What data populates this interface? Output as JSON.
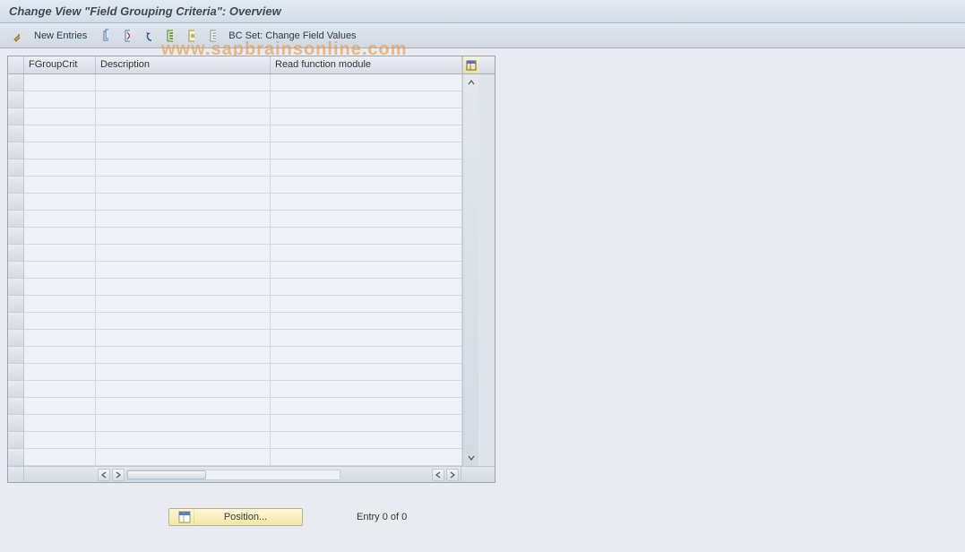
{
  "title": "Change View \"Field Grouping Criteria\": Overview",
  "toolbar": {
    "new_entries": "New Entries",
    "bc_set_label": "BC Set: Change Field Values"
  },
  "watermark": "www.sapbrainsonline.com",
  "grid": {
    "columns": {
      "fgroupcrit": "FGroupCrit",
      "description": "Description",
      "read_fm": "Read function module"
    },
    "row_count": 23
  },
  "footer": {
    "position_btn": "Position...",
    "entry_status": "Entry 0 of 0"
  }
}
